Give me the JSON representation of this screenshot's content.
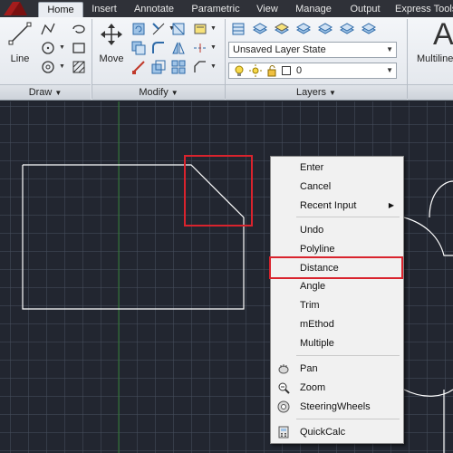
{
  "tabs": [
    "Home",
    "Insert",
    "Annotate",
    "Parametric",
    "View",
    "Manage",
    "Output",
    "Express Tools"
  ],
  "active_tab": "Home",
  "ribbon": {
    "draw": {
      "line_label": "Line",
      "title": "Draw"
    },
    "modify": {
      "move_label": "Move",
      "title": "Modify"
    },
    "layers": {
      "layer_state": "Unsaved Layer State",
      "current_layer": "0",
      "title": "Layers"
    },
    "annotation": {
      "big_letter": "A",
      "multiline_label": "Multiline"
    }
  },
  "context_menu": {
    "items": [
      {
        "label": "Enter"
      },
      {
        "label": "Cancel"
      },
      {
        "label": "Recent Input",
        "submenu": true
      },
      {
        "label": "Undo"
      },
      {
        "label": "Polyline"
      },
      {
        "label": "Distance",
        "highlighted": true
      },
      {
        "label": "Angle"
      },
      {
        "label": "Trim"
      },
      {
        "label": "mEthod"
      },
      {
        "label": "Multiple"
      },
      {
        "label": "Pan",
        "icon": "pan-icon"
      },
      {
        "label": "Zoom",
        "icon": "zoom-icon"
      },
      {
        "label": "SteeringWheels",
        "icon": "steeringwheels-icon"
      },
      {
        "label": "QuickCalc",
        "icon": "calculator-icon"
      }
    ]
  },
  "colors": {
    "canvas": "#222630",
    "geometry": "#ffffff",
    "highlight": "#d9232d",
    "axis": "#2f7a2f"
  }
}
